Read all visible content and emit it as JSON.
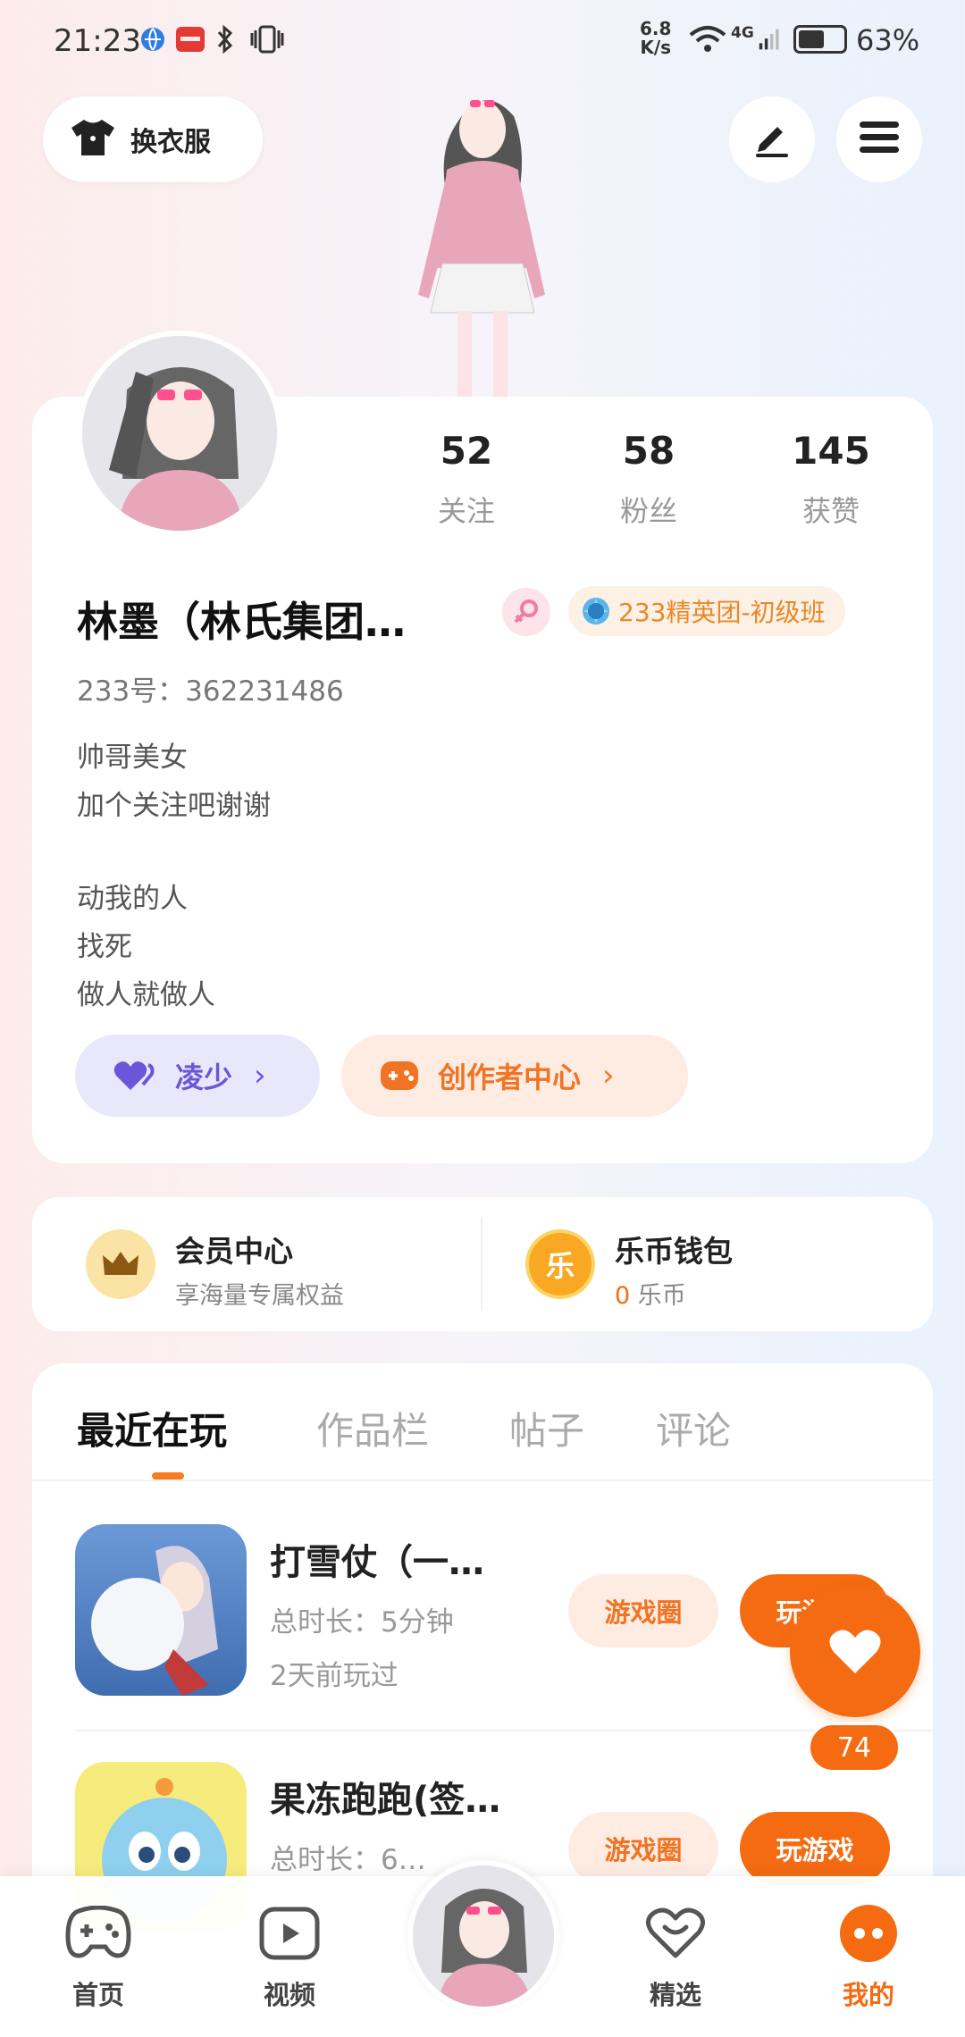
{
  "status_bar": {
    "time": "21:23",
    "net_speed_value": "6.8",
    "net_speed_unit": "K/s",
    "network_type": "4G",
    "battery_percent_label": "63%",
    "battery_level": 0.63
  },
  "top_bar": {
    "outfit_label": "换衣服",
    "icons": [
      "tshirt-icon",
      "edit-icon",
      "menu-icon"
    ]
  },
  "profile": {
    "stats": [
      {
        "value": "52",
        "label": "关注"
      },
      {
        "value": "58",
        "label": "粉丝"
      },
      {
        "value": "145",
        "label": "获赞"
      }
    ],
    "nickname": "林墨（林氏集团…",
    "group_badge": "233精英团-初级班",
    "uid": "233号：362231486",
    "bio": [
      "帅哥美女",
      "加个关注吧谢谢",
      "",
      "动我的人",
      "找死",
      "做人就做人"
    ],
    "chips": {
      "partner": "凌少",
      "creator": "创作者中心"
    }
  },
  "wallet": {
    "member_title": "会员中心",
    "member_sub": "享海量专属权益",
    "coin_title": "乐币钱包",
    "coin_amount": "0",
    "coin_unit": "乐币",
    "coin_glyph": "乐"
  },
  "tabs": [
    "最近在玩",
    "作品栏",
    "帖子",
    "评论"
  ],
  "active_tab": "最近在玩",
  "games": [
    {
      "title": "打雪仗（一…",
      "duration": "总时长：5分钟",
      "last_played": "2天前玩过"
    },
    {
      "title": "果冻跑跑(签…",
      "duration": "总时长：6…",
      "last_played": ""
    }
  ],
  "game_buttons": {
    "circle": "游戏圈",
    "play": "玩游戏"
  },
  "like": {
    "count": "74"
  },
  "bottom_nav": [
    {
      "label": "首页",
      "icon": "gamepad-icon"
    },
    {
      "label": "视频",
      "icon": "video-icon"
    },
    {
      "label": "精选",
      "icon": "heart-icon"
    },
    {
      "label": "我的",
      "icon": "profile-icon"
    }
  ],
  "colors": {
    "accent": "#f46b12",
    "purple": "#6b55d8",
    "badge_bg": "#fdf0e4"
  }
}
